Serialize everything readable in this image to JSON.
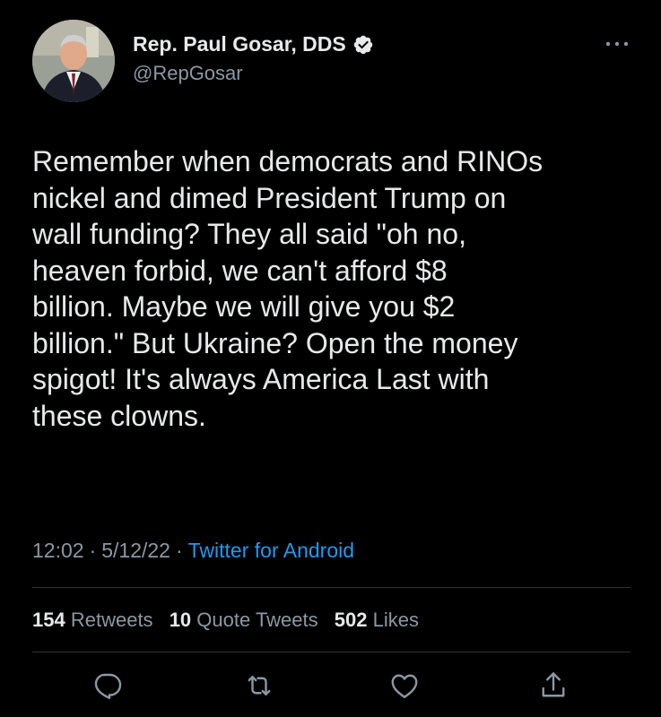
{
  "tweet": {
    "author": {
      "display_name": "Rep. Paul Gosar, DDS",
      "handle": "@RepGosar",
      "verified": true
    },
    "text": "Remember when democrats and RINOs\nnickel and dimed President Trump on\nwall funding? They all said \"oh no,\nheaven forbid, we can't afford $8\nbillion. Maybe we will give you $2\nbillion.\" But Ukraine? Open the money\nspigot! It's always America Last with\nthese clowns.",
    "time": "12:02",
    "date": "5/12/22",
    "separator": "·",
    "source": "Twitter for Android"
  },
  "stats": {
    "retweets_count": "154",
    "retweets_label": "Retweets",
    "quotes_count": "10",
    "quotes_label": "Quote Tweets",
    "likes_count": "502",
    "likes_label": "Likes"
  },
  "actions": [
    "reply-icon",
    "retweet-icon",
    "like-icon",
    "share-icon"
  ],
  "colors": {
    "background": "#000000",
    "text_primary": "#e7e9ea",
    "text_secondary": "#8b98a5",
    "link": "#1d9bf0",
    "verified": "#e7e9ea"
  }
}
